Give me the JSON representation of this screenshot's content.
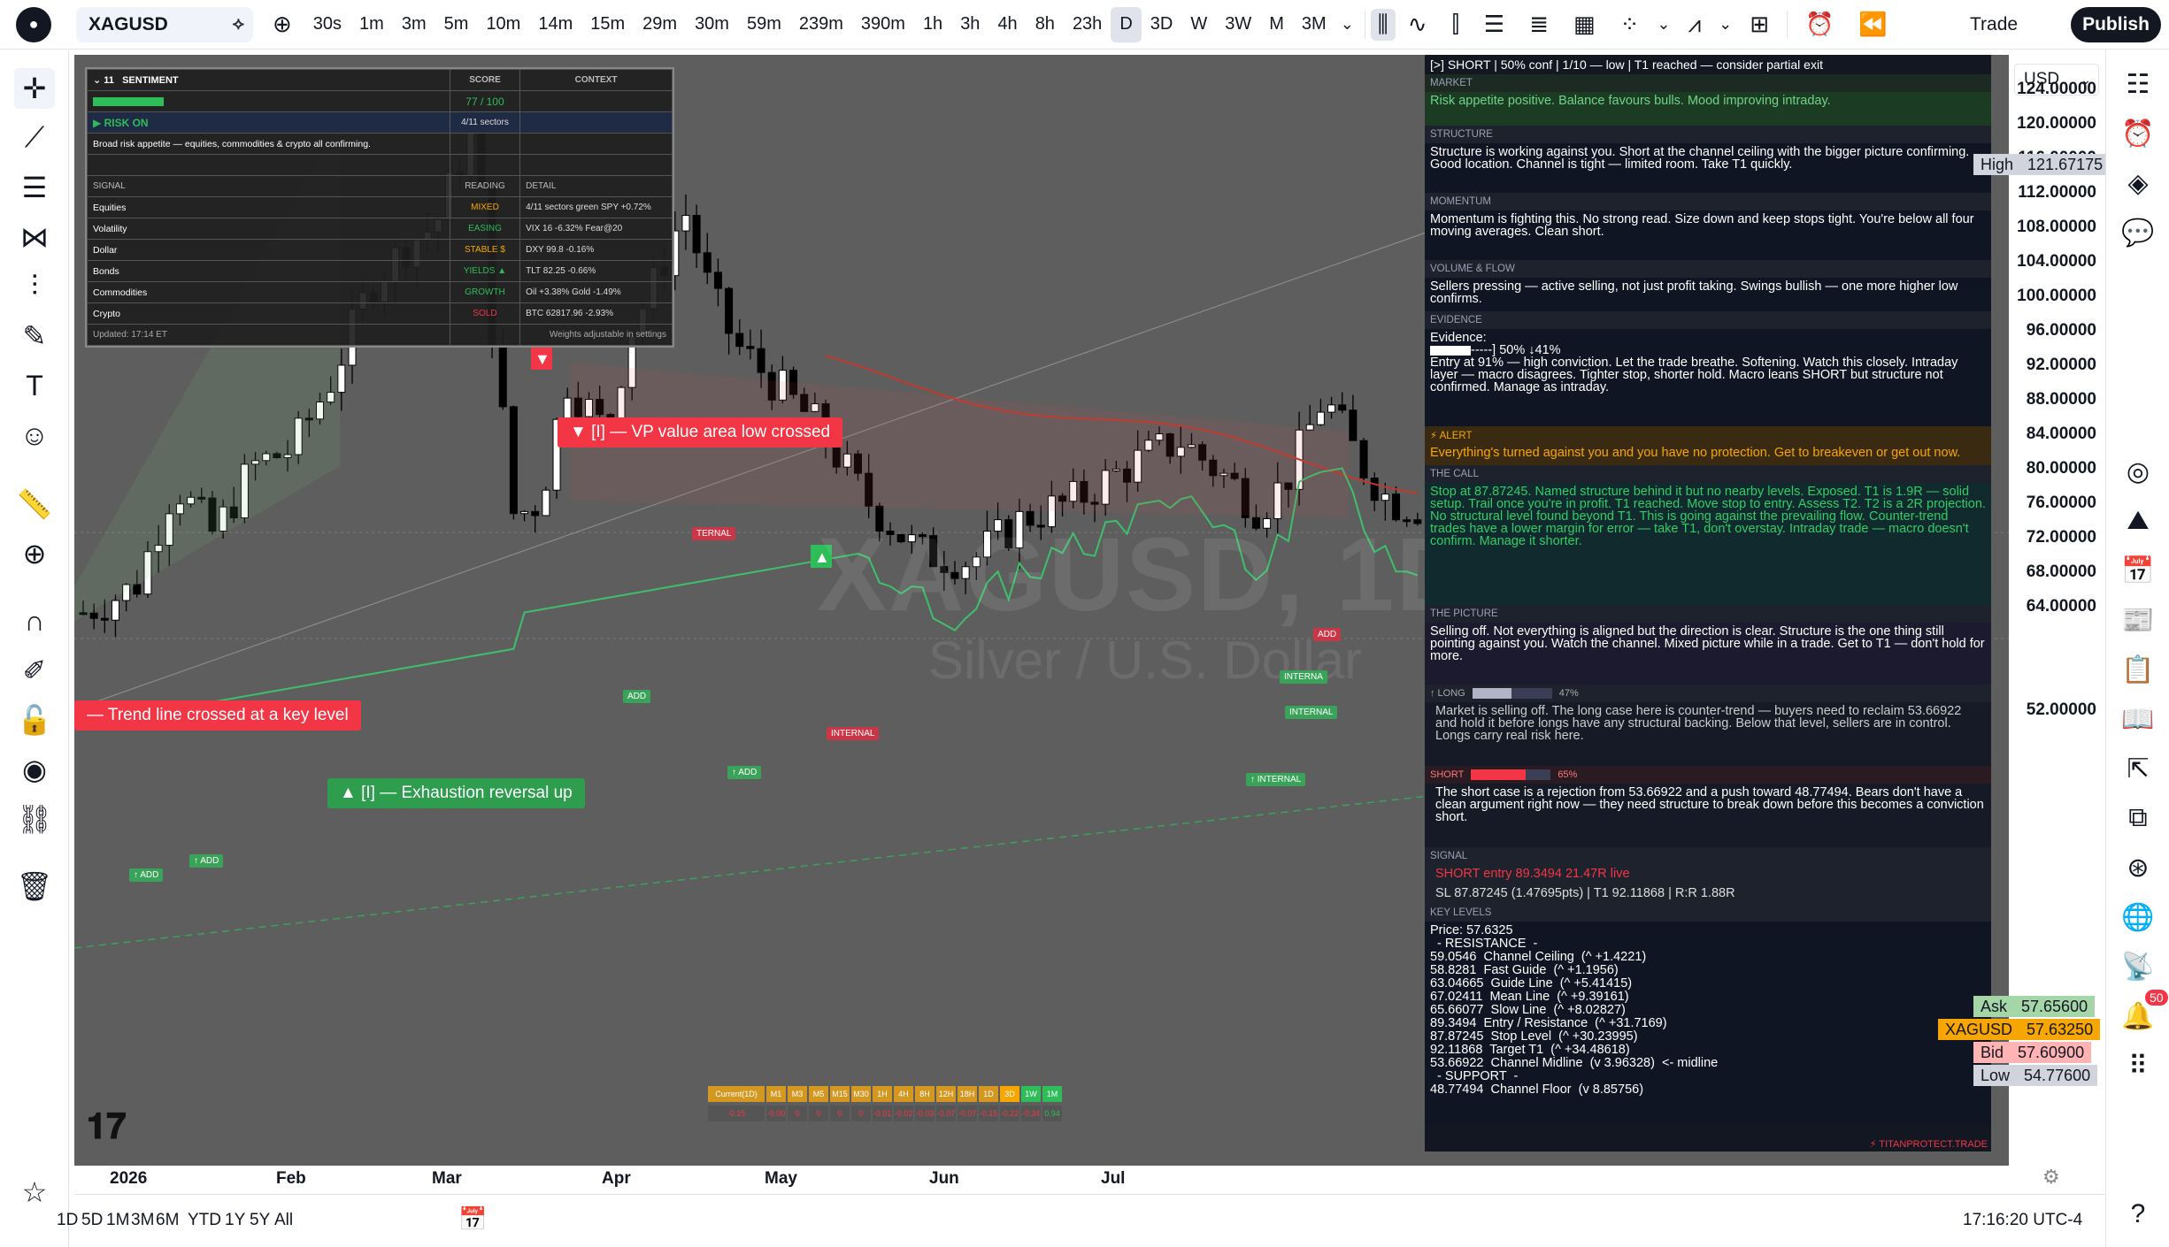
{
  "topbar": {
    "symbol": "XAGUSD",
    "intervals": [
      "30s",
      "1m",
      "3m",
      "5m",
      "10m",
      "14m",
      "15m",
      "29m",
      "30m",
      "59m",
      "239m",
      "390m",
      "1h",
      "3h",
      "4h",
      "8h",
      "23h",
      "D",
      "3D",
      "W",
      "3W",
      "M",
      "3M"
    ],
    "active_interval": "D",
    "trade_label": "Trade",
    "publish_label": "Publish"
  },
  "chart": {
    "watermark_symbol": "XAGUSD, 1D",
    "watermark_desc": "Silver / U.S. Dollar",
    "background": "#5e5e5e",
    "price_labels": [
      "124.00000",
      "120.00000",
      "116.00000",
      "112.00000",
      "108.00000",
      "104.00000",
      "100.00000",
      "96.00000",
      "92.00000",
      "88.00000",
      "84.00000",
      "80.00000",
      "76.00000",
      "72.00000",
      "68.00000",
      "64.00000",
      "52.00000"
    ],
    "time_labels": [
      "2026",
      "Feb",
      "Mar",
      "Apr",
      "May",
      "Jun",
      "Jul"
    ],
    "annotations": {
      "trendline": "— Trend line crossed at a key level",
      "vp": "▼ [I] — VP value area low crossed",
      "exhaustion": "▲ [I] — Exhaustion reversal up",
      "add": "↑ ADD",
      "add2": "ADD",
      "internal": "INTERNAL",
      "internal_up": "↑ INTERNAL",
      "internal_short": "INTERNA",
      "ternal": "TERNAL",
      "add_right": "ADD"
    }
  },
  "price_axis": {
    "currency": "USD",
    "high_label": "High",
    "high_value": "121.67175",
    "ask_label": "Ask",
    "ask_value": "57.65600",
    "sym_label": "XAGUSD",
    "sym_value": "57.63250",
    "bid_label": "Bid",
    "bid_value": "57.60900",
    "low_label": "Low",
    "low_value": "54.77600"
  },
  "sentiment": {
    "title": "SENTIMENT",
    "score_h": "SCORE",
    "context_h": "CONTEXT",
    "score": "77 / 100",
    "regime": "▶ RISK ON",
    "sectors": "4/11 sectors",
    "summary": "Broad risk appetite — equities, commodities & crypto all confirming.",
    "signal_h": "SIGNAL",
    "reading_h": "READING",
    "detail_h": "DETAIL",
    "rows": [
      {
        "signal": "Equities",
        "reading": "MIXED",
        "detail": "4/11 sectors green  SPY +0.72%",
        "color": "#f7a600"
      },
      {
        "signal": "Volatility",
        "reading": "EASING",
        "detail": "VIX 16  -6.32%  Fear@20",
        "color": "#2ebd59"
      },
      {
        "signal": "Dollar",
        "reading": "STABLE $",
        "detail": "DXY 99.8  -0.16%",
        "color": "#f7a600"
      },
      {
        "signal": "Bonds",
        "reading": "YIELDS ▲",
        "detail": "TLT 82.25  -0.66%",
        "color": "#2ebd59"
      },
      {
        "signal": "Commodities",
        "reading": "GROWTH",
        "detail": "Oil +3.38%  Gold -1.49%",
        "color": "#2ebd59"
      },
      {
        "signal": "Crypto",
        "reading": "SOLD",
        "detail": "BTC 62817.96  -2.93%",
        "color": "#f23645"
      }
    ],
    "updated": "Updated: 17:14 ET",
    "weights": "Weights adjustable in settings"
  },
  "analysis": {
    "header": "[>]  SHORT  |  50% conf  |  1/10 — low  |  T1 reached — consider partial exit",
    "market_h": "MARKET",
    "market": "Risk appetite positive. Balance favours bulls. Mood improving intraday.",
    "structure_h": "STRUCTURE",
    "structure": "Structure is working against you. Short at the channel ceiling with the bigger picture confirming. Good location. Channel is tight — limited room. Take T1 quickly.",
    "momentum_h": "MOMENTUM",
    "momentum": "Momentum is fighting this. No strong read. Size down and keep stops tight. You're below all four moving averages. Clean short.",
    "volume_h": "VOLUME & FLOW",
    "volume": "Sellers pressing — active selling, not just profit taking. Swings bullish — one more higher low confirms.",
    "evidence_h": "EVIDENCE",
    "evidence_title": "Evidence:",
    "evidence_bar": "-----]  50% ↓41%",
    "evidence_text": "Entry at 91% — high conviction. Let the trade breathe.  Softening. Watch this closely. Intraday layer — macro disagrees. Tighter stop, shorter hold. Macro leans SHORT but structure not confirmed. Manage as intraday.",
    "alert_h": "⚡ ALERT",
    "alert": "Everything's turned against you and you have no protection. Get to breakeven or get out now.",
    "call_h": "THE CALL",
    "call": "Stop at 87.87245. Named structure behind it but no nearby levels. Exposed. T1 is 1.9R — solid setup. Trail once you're in profit. T1 reached. Move stop to entry. Assess T2. T2 is a 2R projection. No structural level found beyond T1. This is going against the prevailing flow. Counter-trend trades have a lower margin for error — take T1, don't overstay. Intraday trade — macro doesn't confirm. Manage it shorter.",
    "picture_h": "THE PICTURE",
    "picture": "Selling off. Not everything is aligned but the direction is clear. Structure is the one thing still pointing against you. Watch the channel. Mixed picture while in a trade. Get to T1 — don't hold for more.",
    "long_label": "↑ LONG",
    "long_pct": "47%",
    "long_text": "Market is selling off. The long case here is counter-trend — buyers need to reclaim 53.66922 and hold it before longs have any structural backing. Below that level, sellers are in control. Longs carry real risk here.",
    "short_label": "SHORT",
    "short_pct": "65%",
    "short_text": "The short case is a rejection from 53.66922 and a push toward 48.77494. Bears don't have a clean argument right now — they need structure to break down before this becomes a conviction short.",
    "signal_h": "SIGNAL",
    "signal_line": "SHORT  entry 89.3494  21.47R live",
    "signal_line2": "SL 87.87245  (1.47695pts)  |  T1 92.11868  |  R:R 1.88R",
    "levels_h": "KEY LEVELS",
    "levels": [
      "Price: 57.6325",
      "  - RESISTANCE  -",
      "59.0546  Channel Ceiling  (^ +1.4221)",
      "58.8281  Fast Guide  (^ +1.1956)",
      "63.04665  Guide Line  (^ +5.41415)",
      "67.02411  Mean Line  (^ +9.39161)",
      "65.66077  Slow Line  (^ +8.02827)",
      "89.3494  Entry / Resistance  (^ +31.7169)",
      "87.87245  Stop Level  (^ +30.23995)",
      "92.11868  Target T1  (^ +34.48618)",
      "53.66922  Channel Midline  (v 3.96328)  <- midline",
      "  - SUPPORT  -",
      "48.77494  Channel Floor  (v 8.85756)"
    ],
    "footer": "⚡ TITANPROTECT.TRADE"
  },
  "mtf": {
    "labels": [
      "Current(1D)",
      "M1",
      "M3",
      "M5",
      "M15",
      "M30",
      "1H",
      "4H",
      "8H",
      "12H",
      "18H",
      "1D",
      "3D",
      "1W",
      "1M"
    ],
    "values": [
      "-0.15",
      "-0.00",
      "0",
      "0",
      "0",
      "0",
      "-0.01",
      "-0.02",
      "-0.03",
      "-0.07",
      "-0.07",
      "-0.15",
      "-0.22",
      "-0.34",
      "0.94"
    ]
  },
  "bottombar": {
    "ranges": [
      "1D",
      "5D",
      "1M",
      "3M",
      "6M",
      "YTD",
      "1Y",
      "5Y",
      "All"
    ],
    "clock": "17:16:20 UTC-4"
  },
  "rightbar": {
    "badge": "50"
  }
}
